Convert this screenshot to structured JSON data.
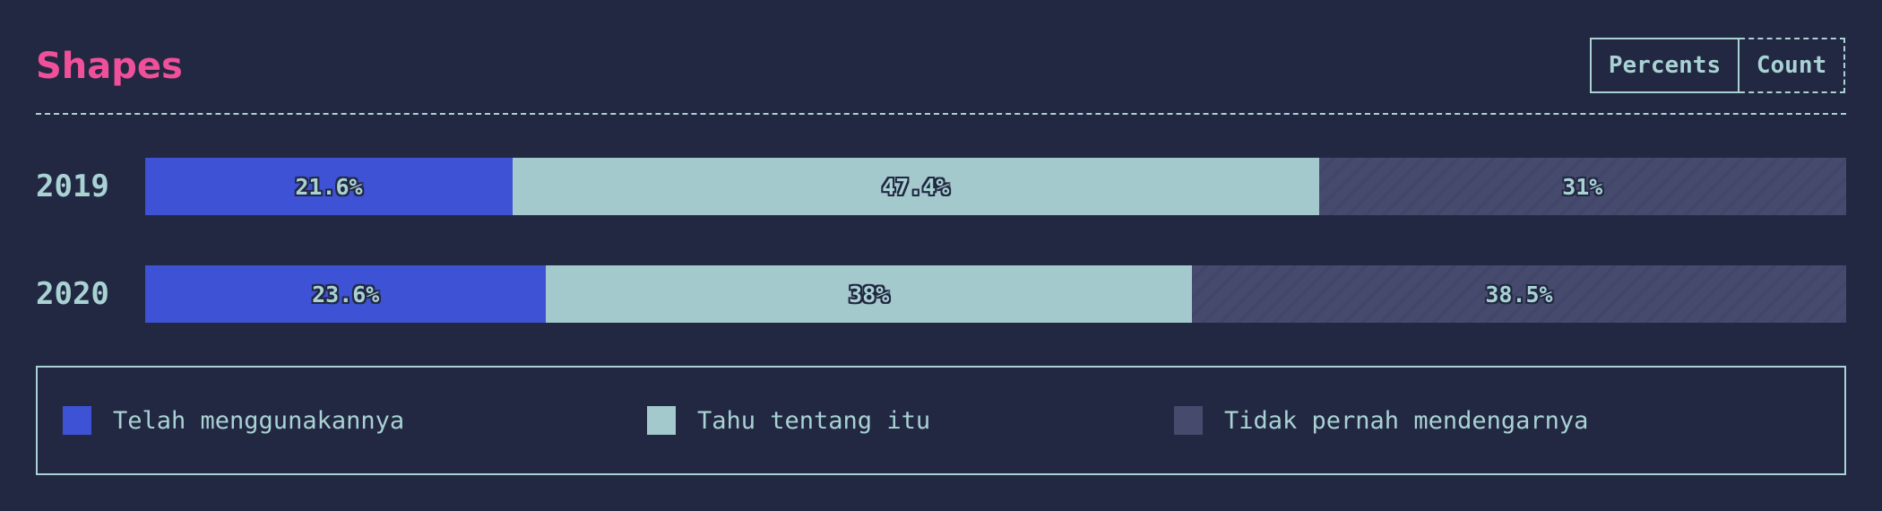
{
  "title": "Shapes",
  "toggle": {
    "active": "Percents",
    "inactive": "Count"
  },
  "colors": {
    "background": "#232842",
    "title": "#f0509a",
    "text": "#a8d2d4",
    "series": [
      "#3d52d5",
      "#a3c9cc",
      "#464b6e"
    ]
  },
  "chart_data": {
    "type": "bar",
    "orientation": "horizontal",
    "stacked": "100%",
    "categories": [
      "2019",
      "2020"
    ],
    "series": [
      {
        "name": "Telah menggunakannya",
        "values": [
          21.6,
          23.6
        ],
        "labels": [
          "21.6%",
          "23.6%"
        ]
      },
      {
        "name": "Tahu tentang itu",
        "values": [
          47.4,
          38.0
        ],
        "labels": [
          "47.4%",
          "38%"
        ]
      },
      {
        "name": "Tidak pernah mendengarnya",
        "values": [
          31.0,
          38.5
        ],
        "labels": [
          "31%",
          "38.5%"
        ]
      }
    ],
    "legend": "bottom"
  }
}
